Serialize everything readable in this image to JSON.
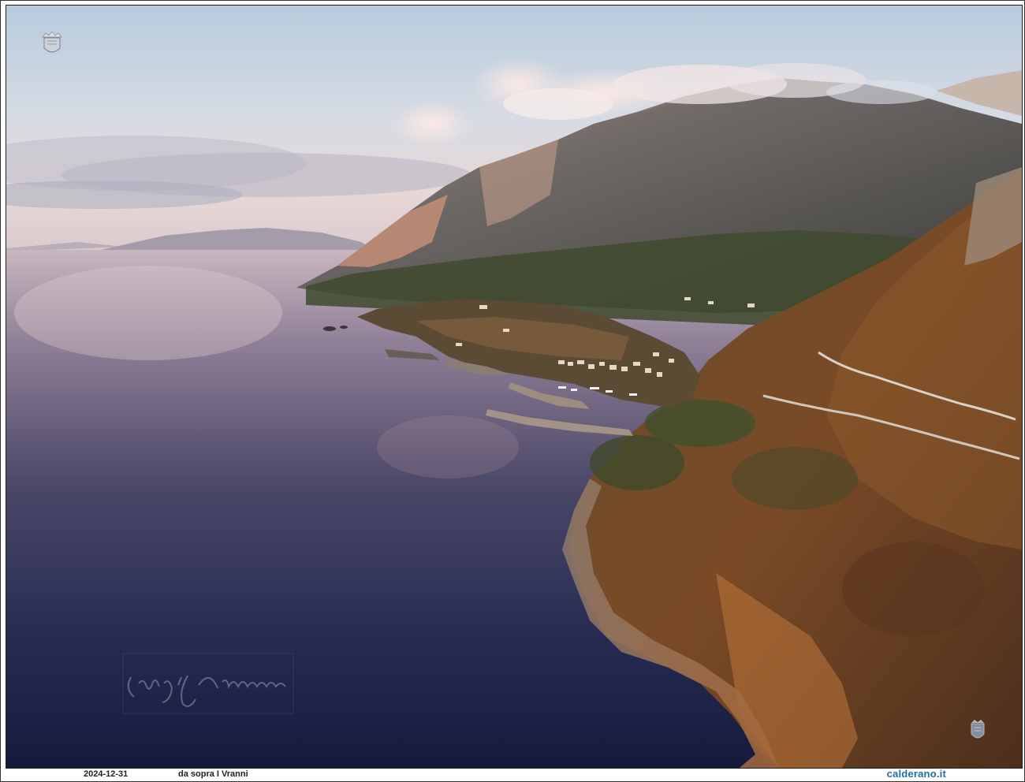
{
  "photo": {
    "alt": "",
    "watermark_signature": "Calderano",
    "logo_top_left": "coat-of-arms-logo",
    "logo_bottom_right": "municipal-shield-logo"
  },
  "caption": {
    "date": "2024-12-31",
    "description": "da sopra I Vranni",
    "site": "calderano.it"
  },
  "colors": {
    "sky_top": "#c9d6e3",
    "sea_dark": "#1c2348",
    "link_blue": "#1b6fae"
  }
}
